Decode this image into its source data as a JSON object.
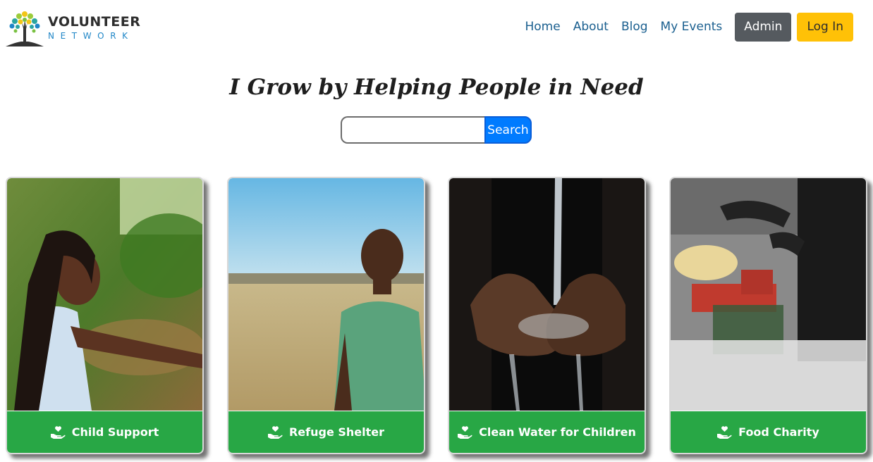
{
  "brand": {
    "title": "VOLUNTEER",
    "subtitle": "NETWORK",
    "icon": "tree-logo-icon"
  },
  "nav": {
    "links": [
      "Home",
      "About",
      "Blog",
      "My Events"
    ],
    "admin_label": "Admin",
    "login_label": "Log In"
  },
  "hero": {
    "tagline": "I Grow by Helping People in Need",
    "search": {
      "value": "",
      "placeholder": "",
      "button_label": "Search"
    }
  },
  "cards": [
    {
      "label": "Child Support",
      "icon": "helping-hand-heart-icon",
      "image": "girl-outdoors-photo"
    },
    {
      "label": "Refuge Shelter",
      "icon": "helping-hand-heart-icon",
      "image": "boy-in-field-photo"
    },
    {
      "label": "Clean Water for Children",
      "icon": "helping-hand-heart-icon",
      "image": "water-in-hands-photo"
    },
    {
      "label": "Food Charity",
      "icon": "helping-hand-heart-icon",
      "image": "food-donation-photo"
    }
  ],
  "colors": {
    "nav_link": "#1a5f8f",
    "admin_button": "#555a5f",
    "login_button": "#ffc107",
    "search_button": "#007bff",
    "card_footer": "#28a745"
  }
}
